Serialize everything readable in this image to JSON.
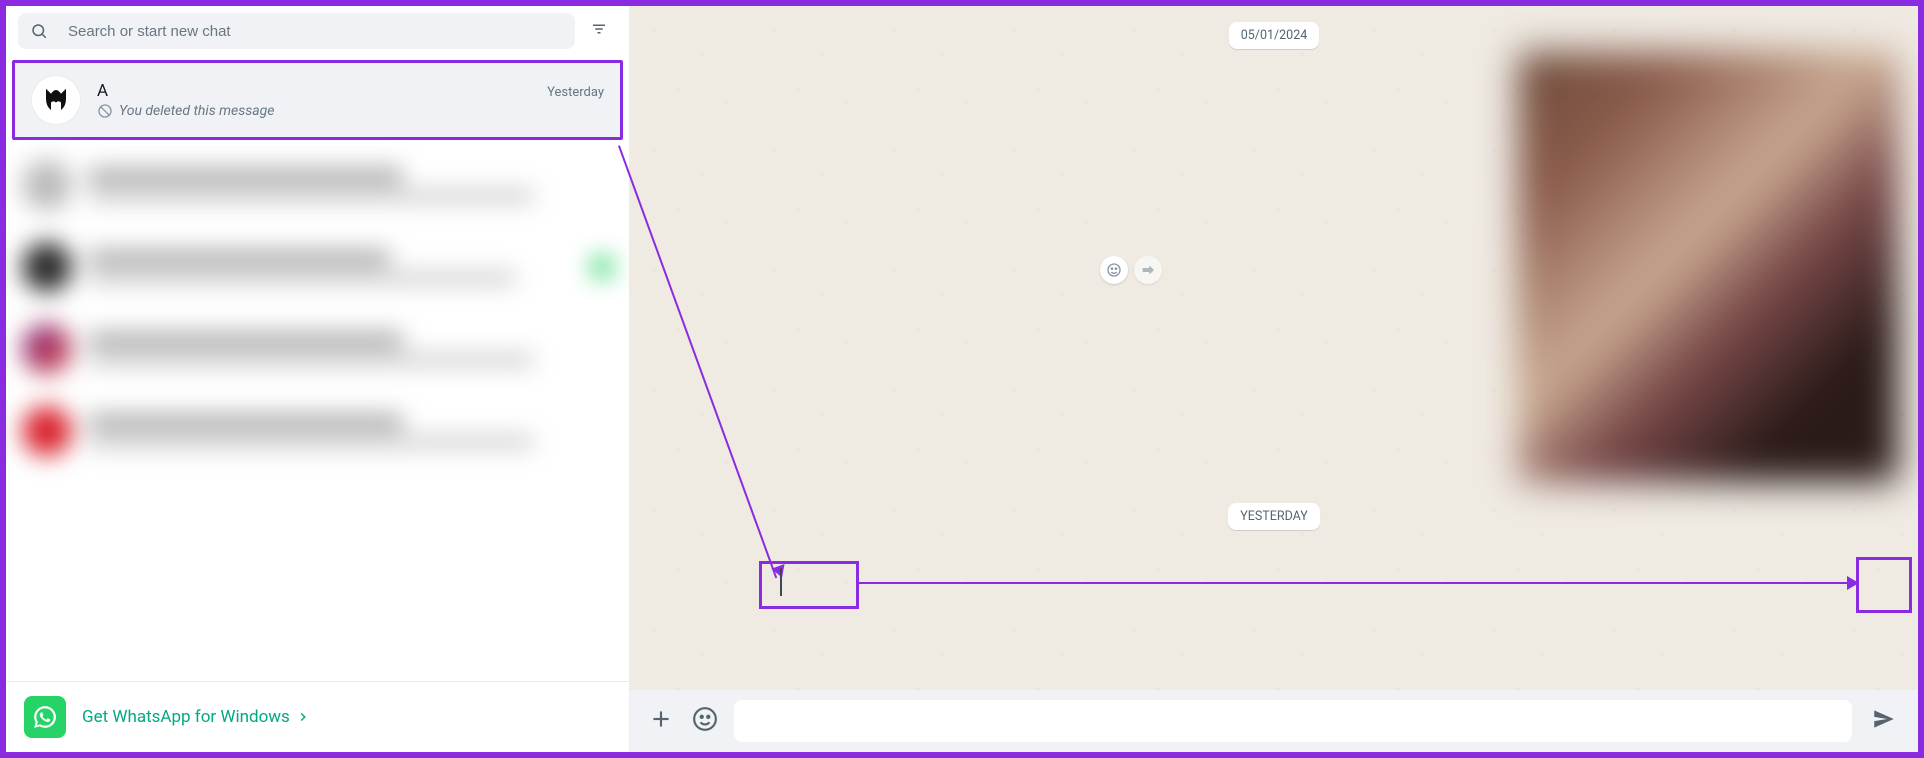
{
  "search": {
    "placeholder": "Search or start new chat",
    "value": ""
  },
  "chats": {
    "highlighted": {
      "name": "A",
      "time": "Yesterday",
      "preview": "You deleted this message"
    }
  },
  "footer": {
    "text": "Get WhatsApp for Windows"
  },
  "conversation": {
    "date_pills": {
      "top": "05/01/2024",
      "bottom": "YESTERDAY"
    }
  },
  "composer": {
    "placeholder": "",
    "value": ""
  },
  "icons": {
    "search": "search-icon",
    "filter": "filter-icon",
    "ban": "ban-icon",
    "whatsapp": "whatsapp-logo",
    "chevron": "chevron-right-icon",
    "plus": "plus-icon",
    "emoji": "emoji-icon",
    "send": "send-icon",
    "smile": "smile-icon"
  }
}
